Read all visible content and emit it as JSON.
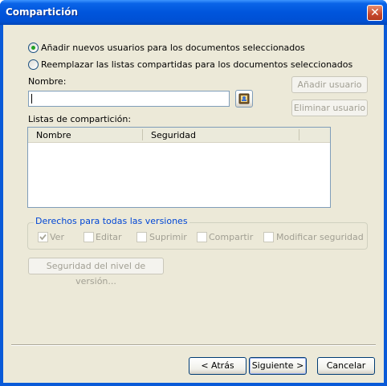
{
  "window": {
    "title": "Compartición"
  },
  "options": {
    "add_users": "Añadir nuevos usuarios para los documentos seleccionados",
    "replace_lists": "Reemplazar las listas compartidas para los documentos seleccionados",
    "selected": "add_users"
  },
  "name_field": {
    "label": "Nombre:",
    "value": ""
  },
  "buttons": {
    "add_user": "Añadir usuario",
    "remove_user": "Eliminar usuario",
    "version_security": "Seguridad del nivel de versión...",
    "back": "< Atrás",
    "next": "Siguiente >",
    "cancel": "Cancelar"
  },
  "sharing_lists": {
    "label": "Listas de compartición:",
    "columns": [
      "Nombre",
      "Seguridad"
    ],
    "rows": []
  },
  "rights": {
    "legend": "Derechos para todas las versiones",
    "checkboxes": [
      {
        "label": "Ver",
        "checked": true
      },
      {
        "label": "Editar",
        "checked": false
      },
      {
        "label": "Suprimir",
        "checked": false
      },
      {
        "label": "Compartir",
        "checked": false
      },
      {
        "label": "Modificar seguridad",
        "checked": false
      }
    ]
  },
  "colors": {
    "title_bar": "#0055dc",
    "dialog_bg": "#ece9d8",
    "legend_text": "#0046d5",
    "radio_dot": "#21a121"
  },
  "icons": {
    "close": "close-icon",
    "address_book": "address-book-icon"
  }
}
